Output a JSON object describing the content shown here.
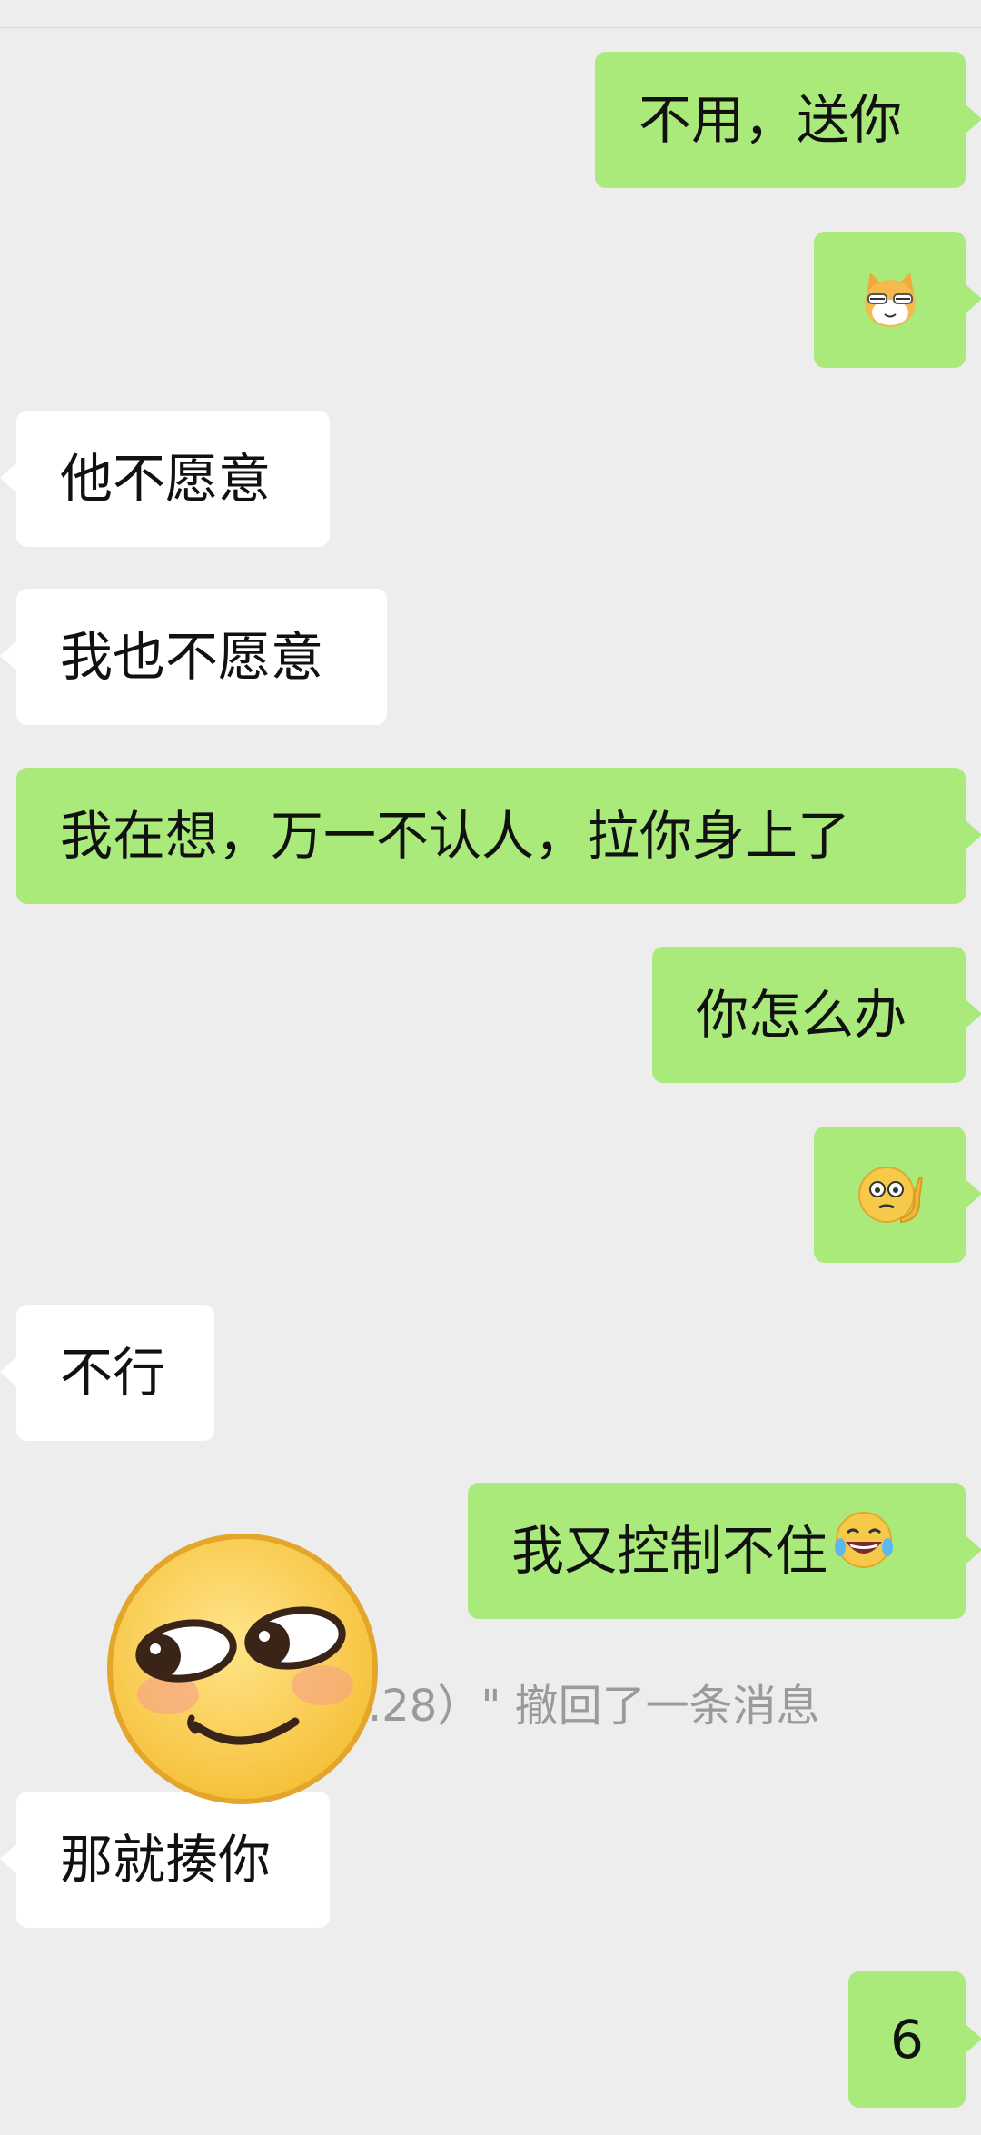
{
  "messages": [
    {
      "side": "out",
      "type": "text",
      "text": "不用，送你"
    },
    {
      "side": "out",
      "type": "emoji",
      "emoji": "cat-face-icon"
    },
    {
      "side": "in",
      "type": "text",
      "text": "他不愿意"
    },
    {
      "side": "in",
      "type": "text",
      "text": "我也不愿意"
    },
    {
      "side": "out",
      "type": "text",
      "text": "我在想，万一不认人，拉你身上了"
    },
    {
      "side": "out",
      "type": "text",
      "text": "你怎么办"
    },
    {
      "side": "out",
      "type": "emoji",
      "emoji": "thinking-face-icon"
    },
    {
      "side": "in",
      "type": "text",
      "text": "不行"
    },
    {
      "side": "out",
      "type": "text",
      "text": "我又控制不住",
      "trailing_emoji": "laughing-tears-icon"
    },
    {
      "side": "in",
      "type": "text",
      "text": "那就揍你"
    },
    {
      "side": "out",
      "type": "text",
      "text": "6"
    }
  ],
  "recall_notice": ".28）\" 撤回了一条消息",
  "overlay_sticker": "smirk-face-sticker",
  "colors": {
    "background": "#ededed",
    "outgoing": "#a9ea7a",
    "incoming": "#ffffff"
  }
}
